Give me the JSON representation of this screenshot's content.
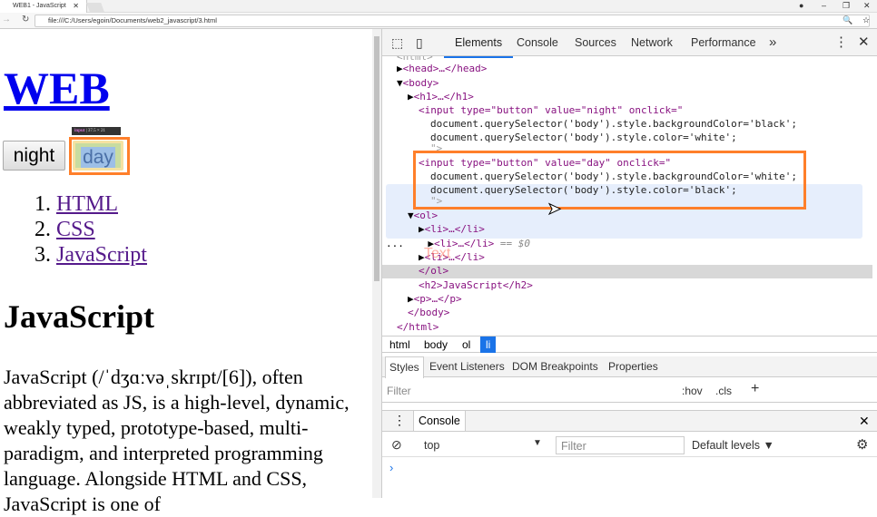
{
  "browser": {
    "tab_title": "WEB1 - JavaScript",
    "url": "file:///C:/Users/egoin/Documents/web2_javascript/3.html"
  },
  "page": {
    "h1": "WEB",
    "buttons": {
      "night": "night",
      "day": "day"
    },
    "tooltip": {
      "tag": "input",
      "size": "37.5 × 21"
    },
    "list": [
      {
        "num": "1.",
        "label": "HTML"
      },
      {
        "num": "2.",
        "label": "CSS"
      },
      {
        "num": "3.",
        "label": "JavaScript"
      }
    ],
    "h2": "JavaScript",
    "paragraph": "JavaScript (/ˈdʒɑːvəˌskrɪpt/[6]), often abbreviated as JS, is a high-level, dynamic, weakly typed, prototype-based, multi-paradigm, and interpreted programming language. Alongside HTML and CSS, JavaScript is one of"
  },
  "devtools": {
    "tabs": [
      "Elements",
      "Console",
      "Sources",
      "Network",
      "Performance"
    ],
    "more": "»",
    "tree": {
      "head": "<head>…</head>",
      "body": "<body>",
      "h1": "<h1>…</h1>",
      "input1_open": "<input type=\"button\" value=\"night\" onclick=\"",
      "input1_l1": "document.querySelector('body').style.backgroundColor='black';",
      "input1_l2": "document.querySelector('body').style.color='white';",
      "close_attr": "\">",
      "input2_open": "<input type=\"button\" value=\"day\" onclick=\"",
      "input2_l1": "document.querySelector('body').style.backgroundColor='white';",
      "input2_l2": "document.querySelector('body').style.color='black';",
      "ol": "<ol>",
      "li": "<li>…</li>",
      "selected_marker": "== $0",
      "ol_close": "</ol>",
      "h2": "<h2>JavaScript</h2>",
      "p": "<p>…</p>",
      "body_close": "</body>",
      "html_close": "</html>",
      "html_open": "<html>",
      "dots": "...",
      "overlay_text": "Text"
    },
    "breadcrumbs": [
      "html",
      "body",
      "ol",
      "li"
    ],
    "style_tabs": [
      "Styles",
      "Event Listeners",
      "DOM Breakpoints",
      "Properties"
    ],
    "filter_placeholder": "Filter",
    "hov": ":hov",
    "cls": ".cls",
    "console": {
      "tab": "Console",
      "context": "top",
      "filter_placeholder": "Filter",
      "levels": "Default levels",
      "prompt": "›"
    }
  }
}
